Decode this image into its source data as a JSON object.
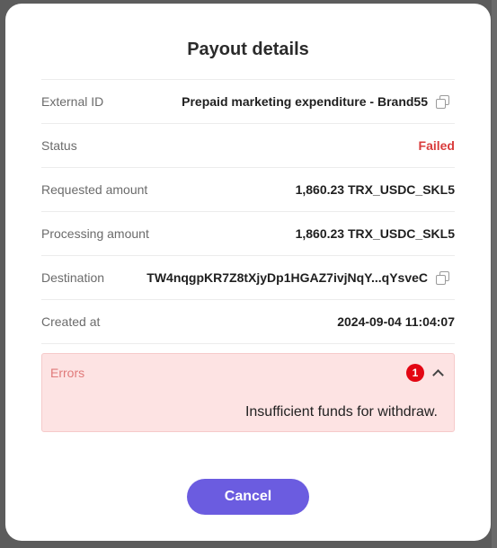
{
  "modal": {
    "title": "Payout details",
    "rows": [
      {
        "label": "External ID",
        "value": "Prepaid marketing expenditure - Brand55"
      },
      {
        "label": "Status",
        "value": "Failed"
      },
      {
        "label": "Requested amount",
        "value": "1,860.23 TRX_USDC_SKL5"
      },
      {
        "label": "Processing amount",
        "value": "1,860.23 TRX_USDC_SKL5"
      },
      {
        "label": "Destination",
        "value": "TW4nqgpKR7Z8tXjyDp1HGAZ7ivjNqY...qYsveC"
      },
      {
        "label": "Created at",
        "value": "2024-09-04 11:04:07"
      }
    ],
    "errors": {
      "label": "Errors",
      "count": "1",
      "message": "Insufficient funds for withdraw."
    },
    "cancel_label": "Cancel"
  },
  "colors": {
    "accent": "#6b5ce0",
    "status_failed": "#d93c3c",
    "error_bg": "#fde3e3",
    "badge": "#e30613"
  }
}
